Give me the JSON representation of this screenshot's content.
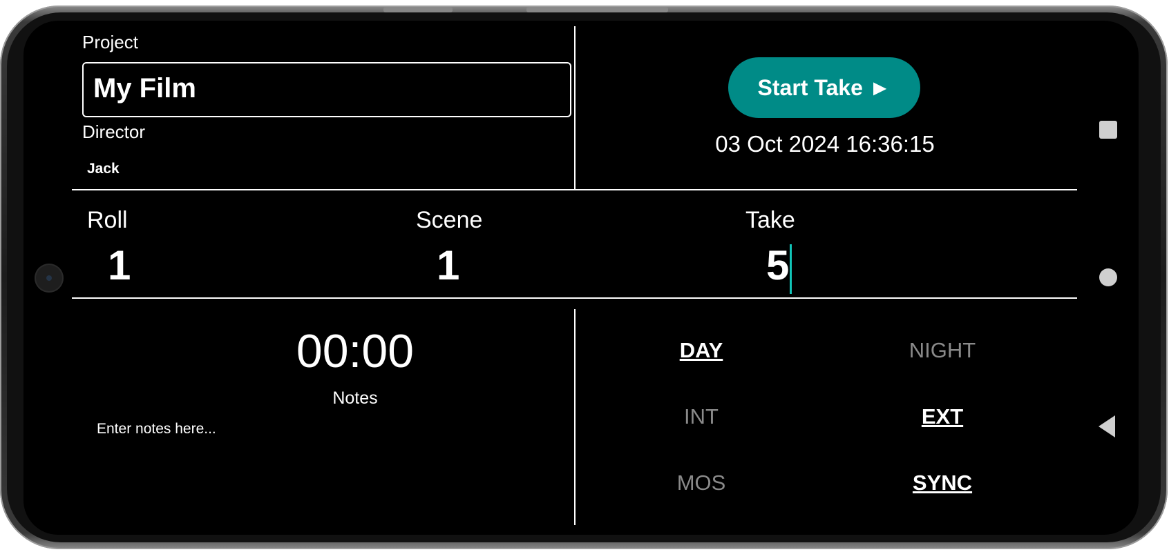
{
  "header": {
    "project_label": "Project",
    "project_value": "My Film",
    "director_label": "Director",
    "director_value": "Jack",
    "start_button_label": "Start Take ►",
    "datetime": "03 Oct 2024 16:36:15"
  },
  "slate": {
    "roll_label": "Roll",
    "roll_value": "1",
    "scene_label": "Scene",
    "scene_value": "1",
    "take_label": "Take",
    "take_value": "5"
  },
  "notes": {
    "timer": "00:00",
    "label": "Notes",
    "placeholder": "Enter notes here..."
  },
  "options": {
    "day": "DAY",
    "night": "NIGHT",
    "int": "INT",
    "ext": "EXT",
    "mos": "MOS",
    "sync": "SYNC",
    "selected": [
      "DAY",
      "EXT",
      "SYNC"
    ]
  },
  "nav": {
    "recents": "square-icon",
    "home": "circle-icon",
    "back": "back-triangle-icon"
  },
  "colors": {
    "accent": "#008b87",
    "cursor": "#11c5b8",
    "inactive": "#8a8a8a",
    "background": "#000000"
  }
}
